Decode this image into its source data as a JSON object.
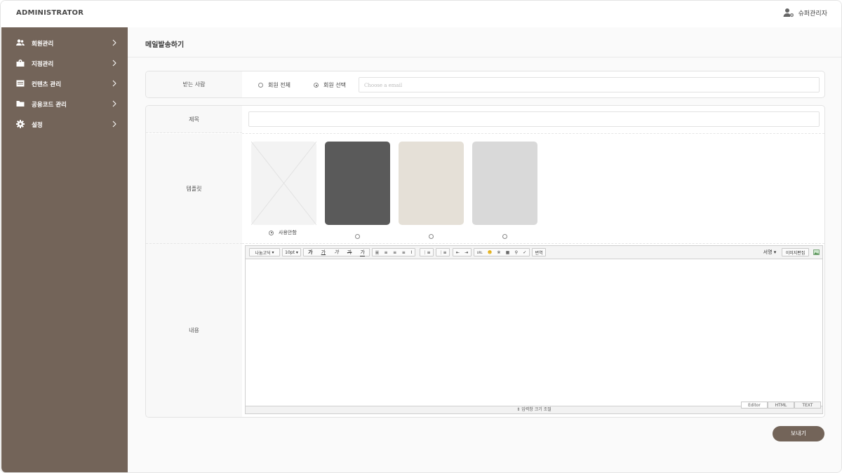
{
  "app": {
    "title": "ADMINISTRATOR"
  },
  "user": {
    "name": "슈퍼관리자",
    "icon": "user-settings-icon"
  },
  "sidebar": {
    "items": [
      {
        "label": "회원관리",
        "icon": "users-icon"
      },
      {
        "label": "지점관리",
        "icon": "branch-icon"
      },
      {
        "label": "컨텐츠 관리",
        "icon": "content-icon"
      },
      {
        "label": "공용코드 관리",
        "icon": "folder-icon"
      },
      {
        "label": "설정",
        "icon": "gear-icon"
      }
    ]
  },
  "page": {
    "title": "메일발송하기"
  },
  "recipients": {
    "label": "받는 사람",
    "options": [
      {
        "label": "회원 전체",
        "selected": false
      },
      {
        "label": "회원 선택",
        "selected": true
      }
    ],
    "email_placeholder": "Choose a email"
  },
  "subject": {
    "label": "제목",
    "value": ""
  },
  "template": {
    "label": "템플릿",
    "items": [
      {
        "caption": "사용안함",
        "selected": true,
        "color": "#f3f3f3",
        "placeholder": true
      },
      {
        "caption": "",
        "selected": false,
        "color": "#5a5a5a"
      },
      {
        "caption": "",
        "selected": false,
        "color": "#e5e0d7"
      },
      {
        "caption": "",
        "selected": false,
        "color": "#d9d9d9"
      }
    ]
  },
  "content": {
    "label": "내용",
    "toolbar": {
      "font": "나눔고딕",
      "size": "10pt",
      "bold": "가",
      "underline": "가",
      "italic": "가",
      "strike": "가",
      "fontcolor": "가",
      "translate": "번역",
      "signature": "서명",
      "image_edit": "이미지편집"
    },
    "resize_label": "⇕ 입력창 크기 조절",
    "modes": [
      "Editor",
      "HTML",
      "TEXT"
    ]
  },
  "actions": {
    "send_label": "보내기"
  },
  "colors": {
    "accent": "#736459",
    "background": "#fafafa"
  }
}
